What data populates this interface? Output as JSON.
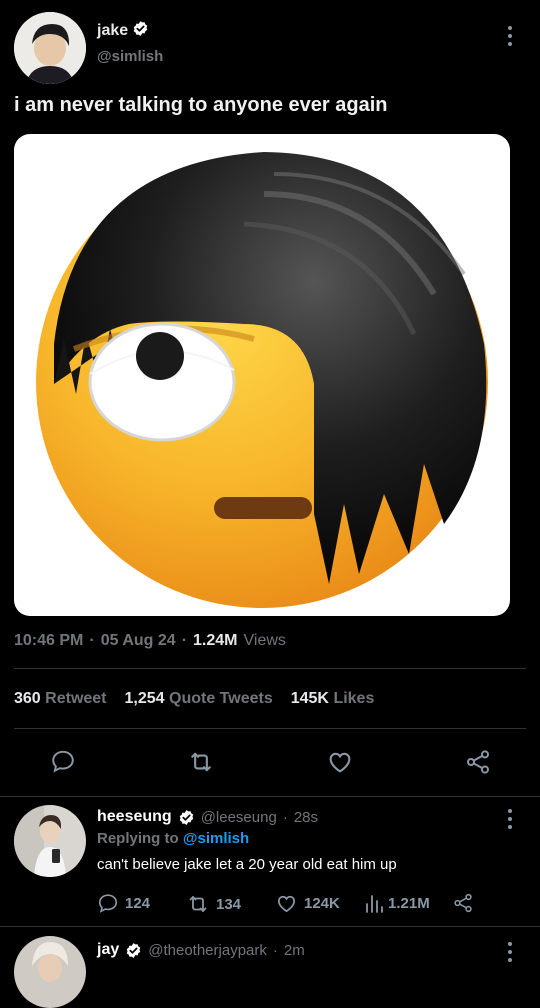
{
  "tweet": {
    "name": "jake",
    "handle": "@simlish",
    "text": "i am never talking to anyone ever again",
    "time": "10:46 PM",
    "date": "05 Aug 24",
    "views_count": "1.24M",
    "views_label": "Views",
    "retweets": "360",
    "retweets_label": "Retweet",
    "quotes": "1,254",
    "quotes_label": "Quote Tweets",
    "likes": "145K",
    "likes_label": "Likes"
  },
  "reply": {
    "name": "heeseung",
    "handle": "@leeseung",
    "time": "28s",
    "replying_prefix": "Replying to",
    "replying_to": "@simlish",
    "text": "can't believe jake let a 20 year old eat him up",
    "reply_count": "124",
    "retweet_count": "134",
    "like_count": "124K",
    "view_count": "1.21M"
  },
  "next_reply": {
    "name": "jay",
    "handle": "@theotherjaypark",
    "time": "2m"
  },
  "colors": {
    "background": "#000000",
    "text": "#e7e9ea",
    "muted": "#71767b",
    "link": "#1d9bf0",
    "verified": "#ffffff",
    "divider": "#2f3336"
  },
  "icons": [
    "verified-badge-icon",
    "more-options-icon",
    "reply-icon",
    "retweet-icon",
    "like-icon",
    "share-icon",
    "views-icon"
  ]
}
